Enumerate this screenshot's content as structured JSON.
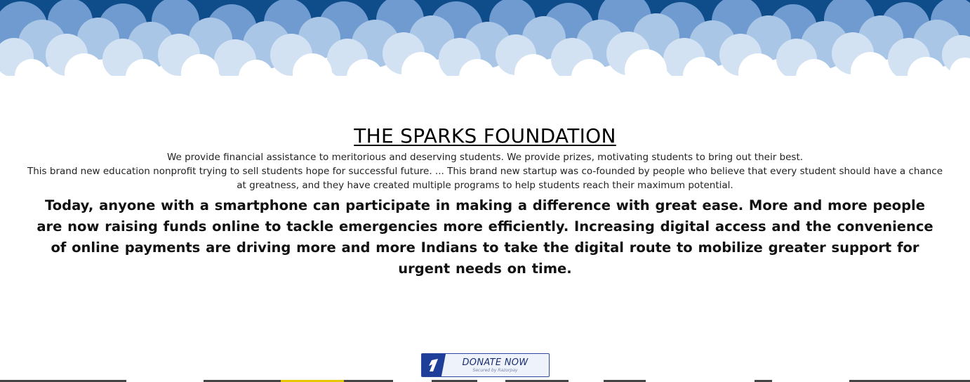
{
  "header": {
    "banner_name": "cloud-banner",
    "sky_color": "#0f4d8a"
  },
  "main": {
    "title": "THE SPARKS FOUNDATION",
    "description_1": "We provide financial assistance to meritorious and deserving students. We provide prizes, motivating students to bring out their best.",
    "description_2": "This brand new education nonprofit trying to sell students hope for successful future. ... This brand new startup was co-founded by people who believe that every student should have a chance at greatness, and they have created multiple programs to help students reach their maximum potential.",
    "lead": "Today, anyone with a smartphone can participate in making a difference with great ease. More and more people are now raising funds online to tackle emergencies more efficiently. Increasing digital access and the convenience of online payments are driving more and more Indians to take the digital route to mobilize greater support for urgent needs on time."
  },
  "donate_button": {
    "label": "DONATE NOW",
    "sublabel": "Secured by Razorpay",
    "icon": "razorpay-icon",
    "accent": "#1f3e9a"
  }
}
